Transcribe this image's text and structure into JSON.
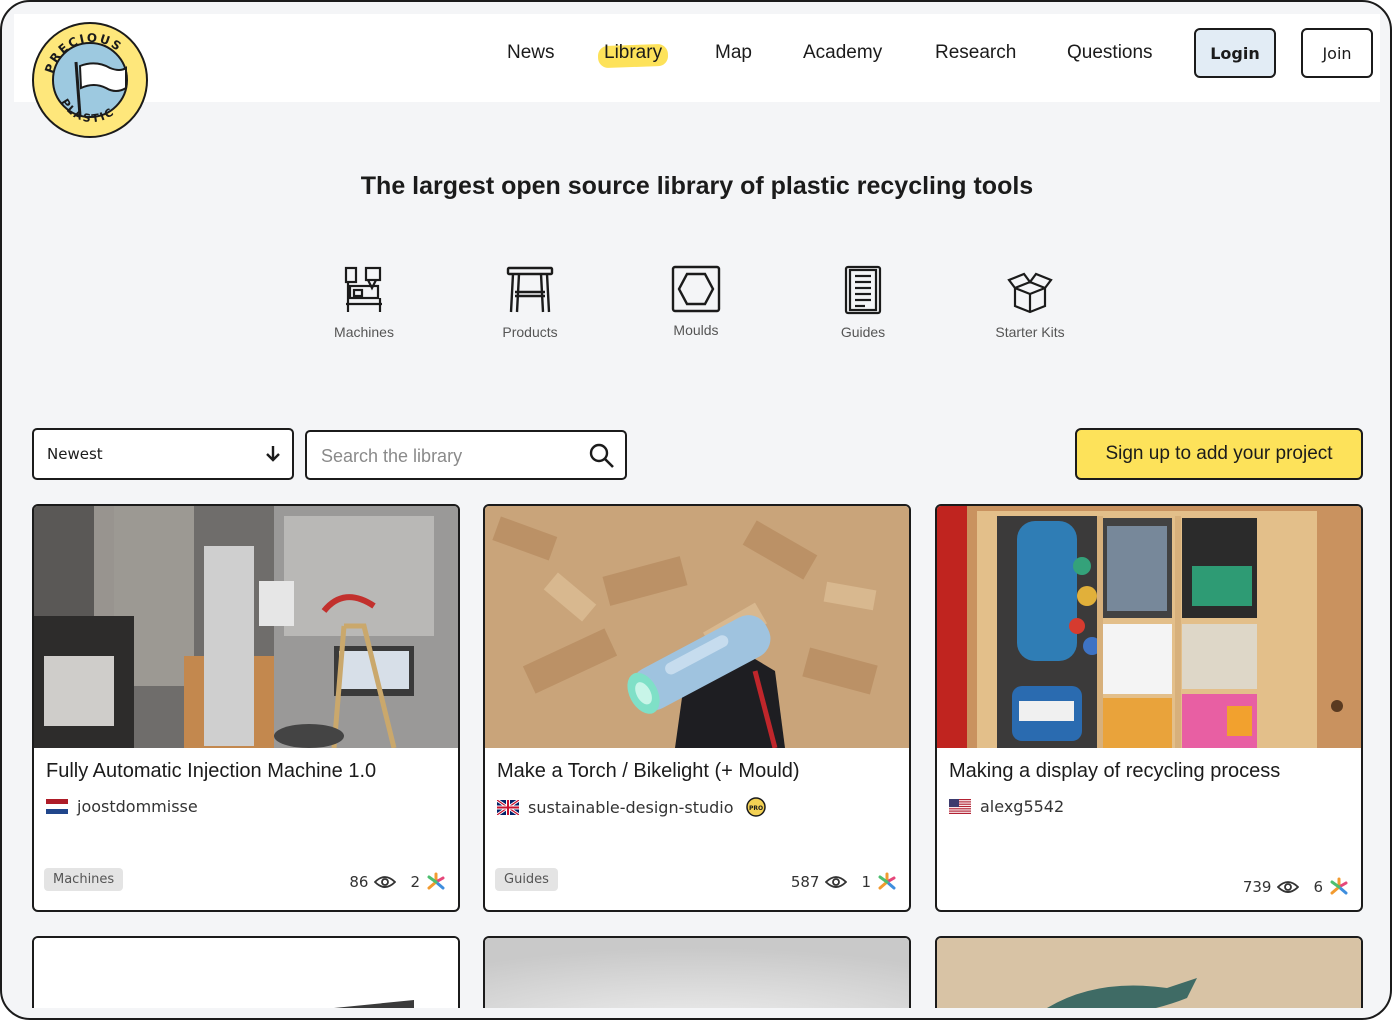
{
  "brand": {
    "logo_top": "PRECIOUS",
    "logo_bottom": "PLASTIC",
    "accent": "#fde25a"
  },
  "nav": {
    "items": [
      {
        "label": "News"
      },
      {
        "label": "Library"
      },
      {
        "label": "Map"
      },
      {
        "label": "Academy"
      },
      {
        "label": "Research"
      },
      {
        "label": "Questions"
      }
    ],
    "active": "Library",
    "login_label": "Login",
    "join_label": "Join"
  },
  "hero": {
    "title": "The largest open source library of plastic recycling tools"
  },
  "categories": [
    {
      "label": "Machines",
      "icon": "machine-icon"
    },
    {
      "label": "Products",
      "icon": "stool-icon"
    },
    {
      "label": "Moulds",
      "icon": "mould-icon"
    },
    {
      "label": "Guides",
      "icon": "guide-book-icon"
    },
    {
      "label": "Starter Kits",
      "icon": "box-icon"
    }
  ],
  "filters": {
    "sort_value": "Newest",
    "search_placeholder": "Search the library",
    "signup_label": "Sign up to add your project"
  },
  "cards": [
    {
      "title": "Fully Automatic Injection Machine 1.0",
      "author": "joostdommisse",
      "flag": "NL",
      "tag": "Machines",
      "views": "86",
      "useful": "2"
    },
    {
      "title": "Make a Torch / Bikelight (+ Mould)",
      "author": "sustainable-design-studio",
      "flag": "GB",
      "badge": "PRO",
      "tag": "Guides",
      "views": "587",
      "useful": "1"
    },
    {
      "title": "Making a display of recycling process",
      "author": "alexg5542",
      "flag": "US",
      "tag": "",
      "views": "739",
      "useful": "6"
    }
  ]
}
